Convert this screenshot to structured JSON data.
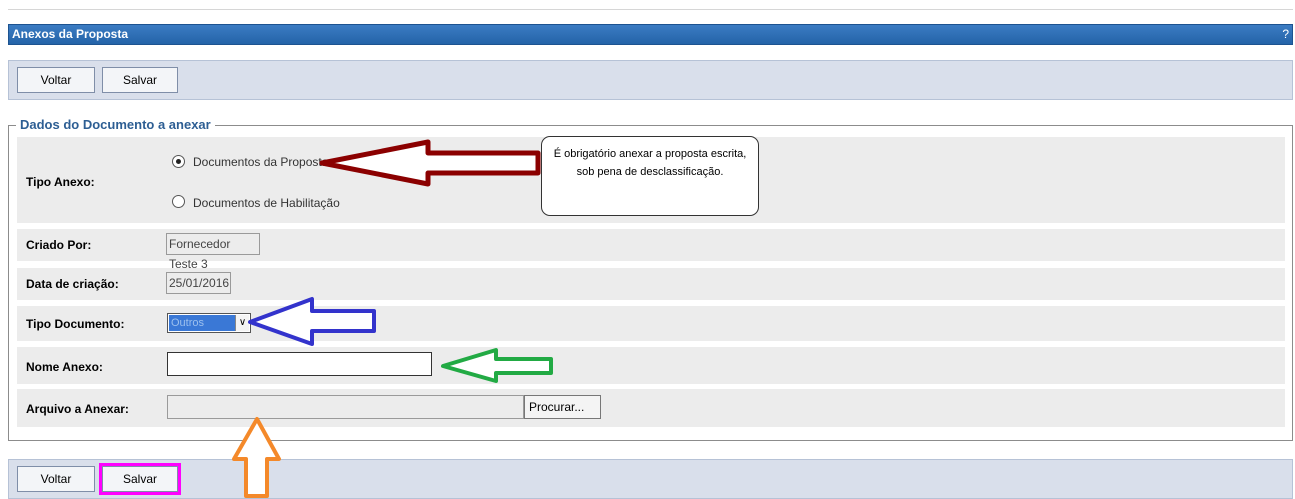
{
  "window": {
    "title": "Anexos da Proposta",
    "help": "?"
  },
  "toolbar_top": {
    "back_label": "Voltar",
    "save_label": "Salvar"
  },
  "toolbar_bottom": {
    "back_label": "Voltar",
    "save_label": "Salvar"
  },
  "section": {
    "legend": "Dados do Documento a anexar"
  },
  "form": {
    "tipo_anexo": {
      "label": "Tipo Anexo:",
      "options": [
        "Documentos da Proposta",
        "Documentos de Habilitação"
      ],
      "selected": "Documentos da Proposta"
    },
    "criado_por": {
      "label": "Criado Por:",
      "value": "Fornecedor Teste 3"
    },
    "data_criacao": {
      "label": "Data de criação:",
      "value": "25/01/2016"
    },
    "tipo_documento": {
      "label": "Tipo Documento:",
      "value": "Outros"
    },
    "nome_anexo": {
      "label": "Nome Anexo:",
      "value": ""
    },
    "arquivo": {
      "label": "Arquivo a Anexar:",
      "browse_label": "Procurar..."
    }
  },
  "annotation": {
    "tooltip_lines": [
      "É obrigatório anexar a proposta escrita,",
      "sob pena de desclassificação."
    ]
  },
  "colors": {
    "title_bar": "#2463a8",
    "arrow_red": "#8b0000",
    "arrow_blue": "#3333cc",
    "arrow_green": "#22aa44",
    "arrow_orange": "#f4892a",
    "highlight_magenta": "#ff00ff"
  }
}
